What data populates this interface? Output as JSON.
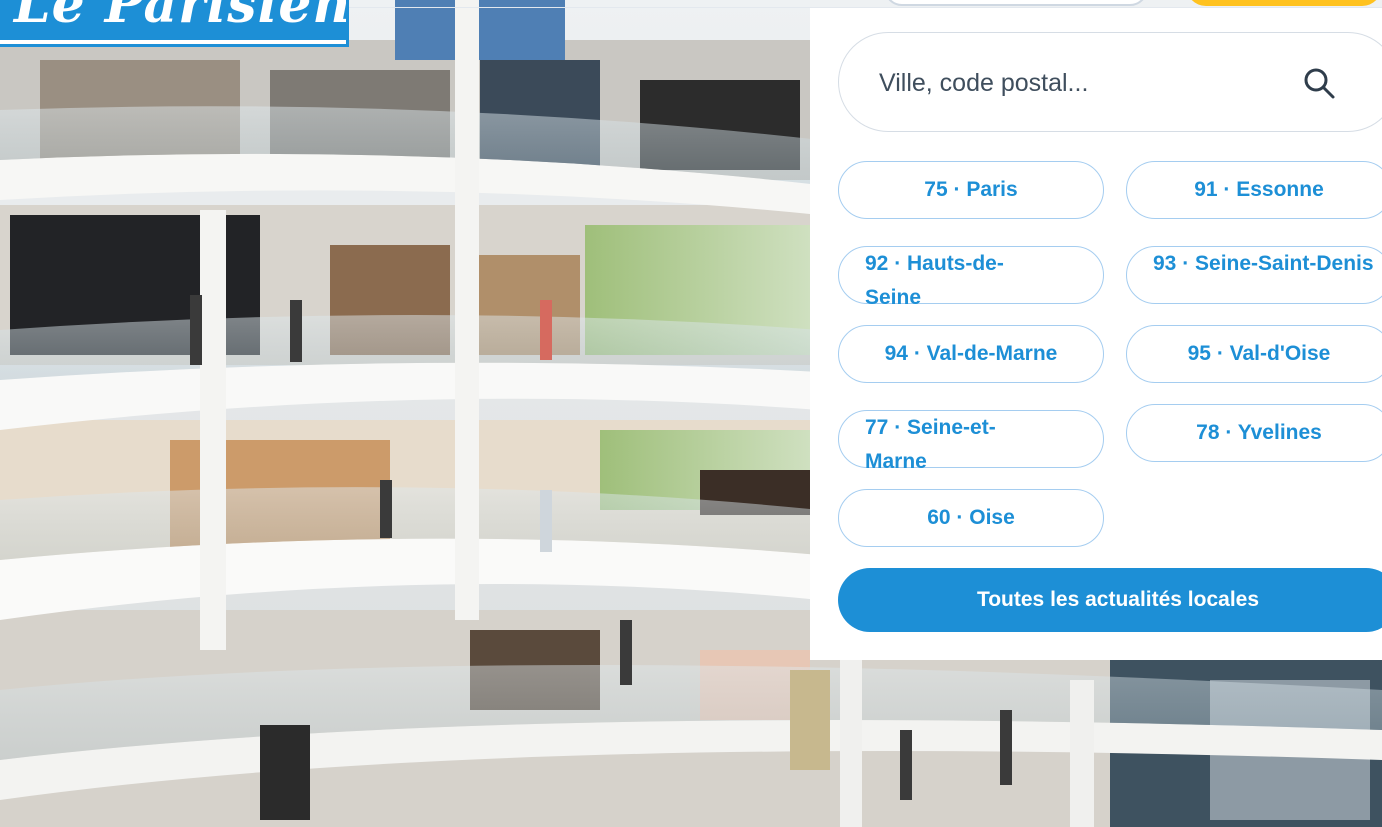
{
  "brand": {
    "logo_text": "Le Parisien",
    "accent": "#1d8fd6",
    "cta_yellow": "#ffc21f"
  },
  "photo": {
    "description_icon": "mall-atrium-photo"
  },
  "local_panel": {
    "search": {
      "placeholder": "Ville, code postal...",
      "value": ""
    },
    "departments": [
      {
        "label": "75 · Paris"
      },
      {
        "label": "91 · Essonne"
      },
      {
        "label": "92 · Hauts-de-Seine"
      },
      {
        "label": "93 · Seine-Saint-Denis"
      },
      {
        "label": "94 · Val-de-Marne"
      },
      {
        "label": "95 · Val-d'Oise"
      },
      {
        "label": "77 · Seine-et-Marne"
      },
      {
        "label": "78 · Yvelines"
      },
      {
        "label": "60 · Oise"
      }
    ],
    "all_news_label": "Toutes les actualités locales"
  }
}
